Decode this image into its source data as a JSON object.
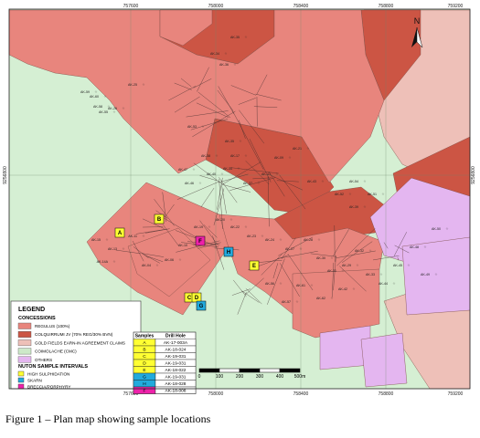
{
  "colors": {
    "background": "#d5efd3",
    "regulus": "#e8857d",
    "colquirrumi": "#cc5544",
    "gold_fields": "#eec0b8",
    "coimolache": "#cde9c9",
    "others": "#e4b6f0",
    "high_sulphidation": "#ffff33",
    "skarn": "#22aadd",
    "breccia": "#ee22aa"
  },
  "grid": {
    "eastings": [
      "757600",
      "758000",
      "758400",
      "758800",
      "759200"
    ],
    "northings": [
      "9256800"
    ]
  },
  "north_arrow": {
    "label": "N"
  },
  "legend": {
    "title": "LEGEND",
    "concessions_title": "CONCESSIONS",
    "concessions": [
      {
        "label": "REGULUS (100%)",
        "color_key": "regulus"
      },
      {
        "label": "COLQUIRRUMI JV (70% REG/30% BVN)",
        "color_key": "colquirrumi"
      },
      {
        "label": "GOLD FIELDS EARN-IN AGREEMENT CLAIMS",
        "color_key": "gold_fields"
      },
      {
        "label": "COIMOLACHE (CMC)",
        "color_key": "coimolache"
      },
      {
        "label": "OTHERS",
        "color_key": "others"
      }
    ],
    "intervals_title": "NUTON SAMPLE INTERVALS",
    "intervals": [
      {
        "label": "HIGH SULPHIDATION",
        "color_key": "high_sulphidation"
      },
      {
        "label": "SKARN",
        "color_key": "skarn"
      },
      {
        "label": "BRECCIA/PORPHYRY",
        "color_key": "breccia"
      }
    ]
  },
  "samples_table": {
    "headers": [
      "Samples",
      "Drill Hole"
    ],
    "rows": [
      {
        "sample": "A",
        "hole": "AK-17-003A",
        "color_key": "high_sulphidation"
      },
      {
        "sample": "B",
        "hole": "AK-18-024",
        "color_key": "high_sulphidation"
      },
      {
        "sample": "C",
        "hole": "AK-19-031",
        "color_key": "high_sulphidation"
      },
      {
        "sample": "D",
        "hole": "AK-19-031",
        "color_key": "high_sulphidation"
      },
      {
        "sample": "E",
        "hole": "AK-18-022",
        "color_key": "high_sulphidation"
      },
      {
        "sample": "G",
        "hole": "AK-19-031",
        "color_key": "skarn"
      },
      {
        "sample": "H",
        "hole": "AK-18-028",
        "color_key": "skarn"
      },
      {
        "sample": "F",
        "hole": "AK-18-008",
        "color_key": "breccia"
      }
    ]
  },
  "scale_bar": {
    "labels": [
      "0",
      "100",
      "200",
      "300",
      "400",
      "500m"
    ]
  },
  "sample_markers": [
    {
      "label": "A",
      "color_key": "high_sulphidation"
    },
    {
      "label": "B",
      "color_key": "high_sulphidation"
    },
    {
      "label": "C",
      "color_key": "high_sulphidation"
    },
    {
      "label": "D",
      "color_key": "high_sulphidation"
    },
    {
      "label": "E",
      "color_key": "high_sulphidation"
    },
    {
      "label": "F",
      "color_key": "breccia"
    },
    {
      "label": "G",
      "color_key": "skarn"
    },
    {
      "label": "H",
      "color_key": "skarn"
    }
  ],
  "hole_labels": [
    "AK-59",
    "AK-60",
    "AK-58",
    "AK-55",
    "AK-26",
    "AK-25",
    "AK-34",
    "AK-35",
    "AK-36",
    "AK-53",
    "AK-38",
    "AK-47",
    "AK-46",
    "AK-40",
    "AK-34",
    "AK-17",
    "AK-37",
    "AK-41",
    "AK-09",
    "AK-21",
    "AK-43",
    "AK-52",
    "AK-39",
    "AK-51",
    "AK-54",
    "AK-35",
    "AK-15",
    "AK-14A",
    "AK-13",
    "AK-11",
    "AK-04",
    "AK-06",
    "AK-10",
    "AK-19",
    "AK-20",
    "AK-22",
    "AK-23",
    "AK-24",
    "AK-27",
    "AK-28",
    "AK-30",
    "AK-31",
    "AK-29",
    "AK-32",
    "AK-33",
    "AK-44",
    "AK-45",
    "AK-48",
    "AK-49",
    "AK-50",
    "AK-56",
    "AK-57",
    "AK-61",
    "AK-62",
    "AK-42"
  ],
  "caption": "Figure 1 – Plan map showing sample locations"
}
